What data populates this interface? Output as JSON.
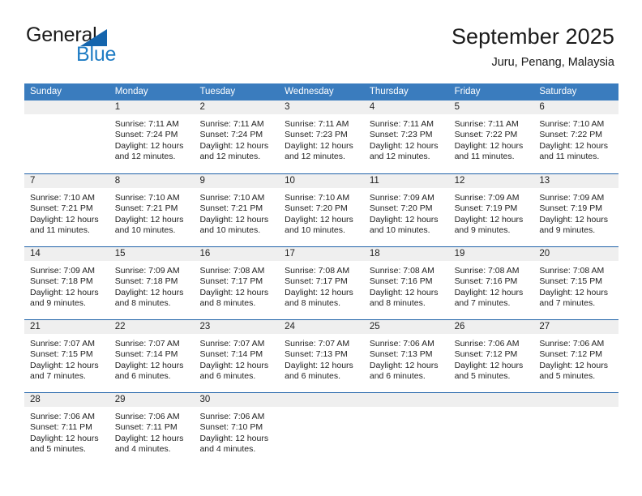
{
  "brand": {
    "name_part1": "General",
    "name_part2": "Blue",
    "triangle_color": "#1565ad",
    "blue_color": "#1f7cc4"
  },
  "header": {
    "title": "September 2025",
    "subtitle": "Juru, Penang, Malaysia"
  },
  "theme": {
    "header_row_bg": "#3a7cbe",
    "row_separator": "#1f62a8",
    "day_band_bg": "#efefef",
    "text": "#222222"
  },
  "weekdays": [
    "Sunday",
    "Monday",
    "Tuesday",
    "Wednesday",
    "Thursday",
    "Friday",
    "Saturday"
  ],
  "weeks": [
    {
      "days": [
        {
          "date": "",
          "empty": true,
          "sunrise": "",
          "sunset": "",
          "daylight_line1": "",
          "daylight_line2": ""
        },
        {
          "date": "1",
          "sunrise": "Sunrise: 7:11 AM",
          "sunset": "Sunset: 7:24 PM",
          "daylight_line1": "Daylight: 12 hours",
          "daylight_line2": "and 12 minutes."
        },
        {
          "date": "2",
          "sunrise": "Sunrise: 7:11 AM",
          "sunset": "Sunset: 7:24 PM",
          "daylight_line1": "Daylight: 12 hours",
          "daylight_line2": "and 12 minutes."
        },
        {
          "date": "3",
          "sunrise": "Sunrise: 7:11 AM",
          "sunset": "Sunset: 7:23 PM",
          "daylight_line1": "Daylight: 12 hours",
          "daylight_line2": "and 12 minutes."
        },
        {
          "date": "4",
          "sunrise": "Sunrise: 7:11 AM",
          "sunset": "Sunset: 7:23 PM",
          "daylight_line1": "Daylight: 12 hours",
          "daylight_line2": "and 12 minutes."
        },
        {
          "date": "5",
          "sunrise": "Sunrise: 7:11 AM",
          "sunset": "Sunset: 7:22 PM",
          "daylight_line1": "Daylight: 12 hours",
          "daylight_line2": "and 11 minutes."
        },
        {
          "date": "6",
          "sunrise": "Sunrise: 7:10 AM",
          "sunset": "Sunset: 7:22 PM",
          "daylight_line1": "Daylight: 12 hours",
          "daylight_line2": "and 11 minutes."
        }
      ]
    },
    {
      "days": [
        {
          "date": "7",
          "sunrise": "Sunrise: 7:10 AM",
          "sunset": "Sunset: 7:21 PM",
          "daylight_line1": "Daylight: 12 hours",
          "daylight_line2": "and 11 minutes."
        },
        {
          "date": "8",
          "sunrise": "Sunrise: 7:10 AM",
          "sunset": "Sunset: 7:21 PM",
          "daylight_line1": "Daylight: 12 hours",
          "daylight_line2": "and 10 minutes."
        },
        {
          "date": "9",
          "sunrise": "Sunrise: 7:10 AM",
          "sunset": "Sunset: 7:21 PM",
          "daylight_line1": "Daylight: 12 hours",
          "daylight_line2": "and 10 minutes."
        },
        {
          "date": "10",
          "sunrise": "Sunrise: 7:10 AM",
          "sunset": "Sunset: 7:20 PM",
          "daylight_line1": "Daylight: 12 hours",
          "daylight_line2": "and 10 minutes."
        },
        {
          "date": "11",
          "sunrise": "Sunrise: 7:09 AM",
          "sunset": "Sunset: 7:20 PM",
          "daylight_line1": "Daylight: 12 hours",
          "daylight_line2": "and 10 minutes."
        },
        {
          "date": "12",
          "sunrise": "Sunrise: 7:09 AM",
          "sunset": "Sunset: 7:19 PM",
          "daylight_line1": "Daylight: 12 hours",
          "daylight_line2": "and 9 minutes."
        },
        {
          "date": "13",
          "sunrise": "Sunrise: 7:09 AM",
          "sunset": "Sunset: 7:19 PM",
          "daylight_line1": "Daylight: 12 hours",
          "daylight_line2": "and 9 minutes."
        }
      ]
    },
    {
      "days": [
        {
          "date": "14",
          "sunrise": "Sunrise: 7:09 AM",
          "sunset": "Sunset: 7:18 PM",
          "daylight_line1": "Daylight: 12 hours",
          "daylight_line2": "and 9 minutes."
        },
        {
          "date": "15",
          "sunrise": "Sunrise: 7:09 AM",
          "sunset": "Sunset: 7:18 PM",
          "daylight_line1": "Daylight: 12 hours",
          "daylight_line2": "and 8 minutes."
        },
        {
          "date": "16",
          "sunrise": "Sunrise: 7:08 AM",
          "sunset": "Sunset: 7:17 PM",
          "daylight_line1": "Daylight: 12 hours",
          "daylight_line2": "and 8 minutes."
        },
        {
          "date": "17",
          "sunrise": "Sunrise: 7:08 AM",
          "sunset": "Sunset: 7:17 PM",
          "daylight_line1": "Daylight: 12 hours",
          "daylight_line2": "and 8 minutes."
        },
        {
          "date": "18",
          "sunrise": "Sunrise: 7:08 AM",
          "sunset": "Sunset: 7:16 PM",
          "daylight_line1": "Daylight: 12 hours",
          "daylight_line2": "and 8 minutes."
        },
        {
          "date": "19",
          "sunrise": "Sunrise: 7:08 AM",
          "sunset": "Sunset: 7:16 PM",
          "daylight_line1": "Daylight: 12 hours",
          "daylight_line2": "and 7 minutes."
        },
        {
          "date": "20",
          "sunrise": "Sunrise: 7:08 AM",
          "sunset": "Sunset: 7:15 PM",
          "daylight_line1": "Daylight: 12 hours",
          "daylight_line2": "and 7 minutes."
        }
      ]
    },
    {
      "days": [
        {
          "date": "21",
          "sunrise": "Sunrise: 7:07 AM",
          "sunset": "Sunset: 7:15 PM",
          "daylight_line1": "Daylight: 12 hours",
          "daylight_line2": "and 7 minutes."
        },
        {
          "date": "22",
          "sunrise": "Sunrise: 7:07 AM",
          "sunset": "Sunset: 7:14 PM",
          "daylight_line1": "Daylight: 12 hours",
          "daylight_line2": "and 6 minutes."
        },
        {
          "date": "23",
          "sunrise": "Sunrise: 7:07 AM",
          "sunset": "Sunset: 7:14 PM",
          "daylight_line1": "Daylight: 12 hours",
          "daylight_line2": "and 6 minutes."
        },
        {
          "date": "24",
          "sunrise": "Sunrise: 7:07 AM",
          "sunset": "Sunset: 7:13 PM",
          "daylight_line1": "Daylight: 12 hours",
          "daylight_line2": "and 6 minutes."
        },
        {
          "date": "25",
          "sunrise": "Sunrise: 7:06 AM",
          "sunset": "Sunset: 7:13 PM",
          "daylight_line1": "Daylight: 12 hours",
          "daylight_line2": "and 6 minutes."
        },
        {
          "date": "26",
          "sunrise": "Sunrise: 7:06 AM",
          "sunset": "Sunset: 7:12 PM",
          "daylight_line1": "Daylight: 12 hours",
          "daylight_line2": "and 5 minutes."
        },
        {
          "date": "27",
          "sunrise": "Sunrise: 7:06 AM",
          "sunset": "Sunset: 7:12 PM",
          "daylight_line1": "Daylight: 12 hours",
          "daylight_line2": "and 5 minutes."
        }
      ]
    },
    {
      "days": [
        {
          "date": "28",
          "sunrise": "Sunrise: 7:06 AM",
          "sunset": "Sunset: 7:11 PM",
          "daylight_line1": "Daylight: 12 hours",
          "daylight_line2": "and 5 minutes."
        },
        {
          "date": "29",
          "sunrise": "Sunrise: 7:06 AM",
          "sunset": "Sunset: 7:11 PM",
          "daylight_line1": "Daylight: 12 hours",
          "daylight_line2": "and 4 minutes."
        },
        {
          "date": "30",
          "sunrise": "Sunrise: 7:06 AM",
          "sunset": "Sunset: 7:10 PM",
          "daylight_line1": "Daylight: 12 hours",
          "daylight_line2": "and 4 minutes."
        },
        {
          "date": "",
          "empty": true,
          "sunrise": "",
          "sunset": "",
          "daylight_line1": "",
          "daylight_line2": ""
        },
        {
          "date": "",
          "empty": true,
          "sunrise": "",
          "sunset": "",
          "daylight_line1": "",
          "daylight_line2": ""
        },
        {
          "date": "",
          "empty": true,
          "sunrise": "",
          "sunset": "",
          "daylight_line1": "",
          "daylight_line2": ""
        },
        {
          "date": "",
          "empty": true,
          "sunrise": "",
          "sunset": "",
          "daylight_line1": "",
          "daylight_line2": ""
        }
      ]
    }
  ]
}
